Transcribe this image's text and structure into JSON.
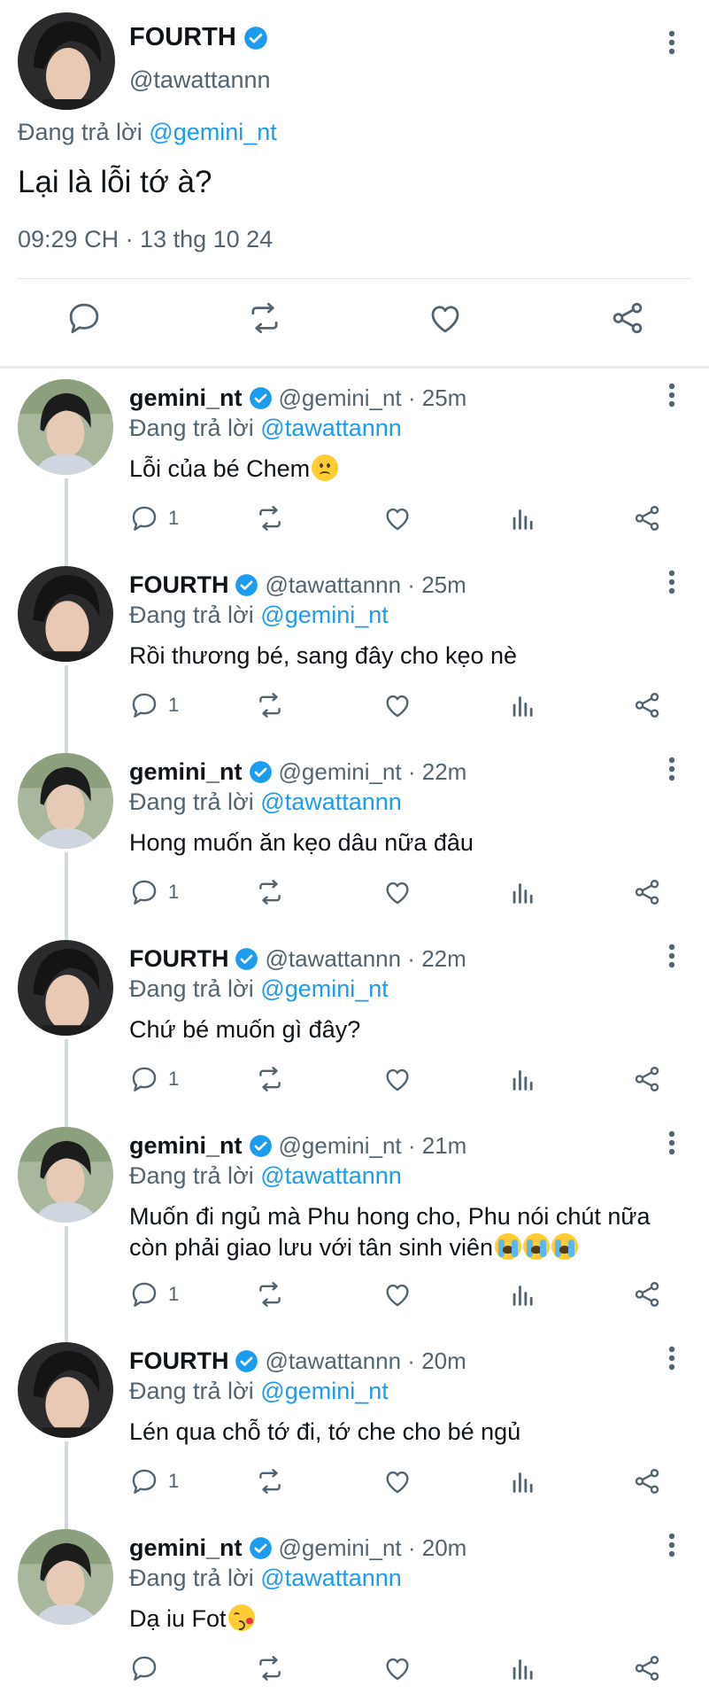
{
  "main_tweet": {
    "name": "FOURTH",
    "handle": "@tawattannn",
    "replying_prefix": "Đang trả lời",
    "replying_to": "@gemini_nt",
    "text": "Lại là lỗi tớ à?",
    "timestamp": "09:29 CH · 13 thg 10 24"
  },
  "replies": [
    {
      "name": "gemini_nt",
      "handle": "@gemini_nt · 25m",
      "replying_prefix": "Đang trả lời",
      "replying_to": "@tawattannn",
      "text": "Lỗi của bé Chem",
      "emoji": "worried-face-emoji",
      "reply_count": "1"
    },
    {
      "name": "FOURTH",
      "handle": "@tawattannn · 25m",
      "replying_prefix": "Đang trả lời",
      "replying_to": "@gemini_nt",
      "text": "Rồi thương bé, sang đây cho kẹo nè",
      "reply_count": "1"
    },
    {
      "name": "gemini_nt",
      "handle": "@gemini_nt · 22m",
      "replying_prefix": "Đang trả lời",
      "replying_to": "@tawattannn",
      "text": "Hong muốn ăn kẹo dâu nữa đâu",
      "reply_count": "1"
    },
    {
      "name": "FOURTH",
      "handle": "@tawattannn · 22m",
      "replying_prefix": "Đang trả lời",
      "replying_to": "@gemini_nt",
      "text": "Chứ bé muốn gì đây?",
      "reply_count": "1"
    },
    {
      "name": "gemini_nt",
      "handle": "@gemini_nt · 21m",
      "replying_prefix": "Đang trả lời",
      "replying_to": "@tawattannn",
      "text": "Muốn đi ngủ mà Phu hong cho, Phu nói chút nữa còn phải giao lưu với tân sinh viên",
      "emoji": "loudly-crying-face-emoji x3",
      "reply_count": "1"
    },
    {
      "name": "FOURTH",
      "handle": "@tawattannn · 20m",
      "replying_prefix": "Đang trả lời",
      "replying_to": "@gemini_nt",
      "text": "Lén qua chỗ tớ đi, tớ che cho bé ngủ",
      "reply_count": "1"
    },
    {
      "name": "gemini_nt",
      "handle": "@gemini_nt · 20m",
      "replying_prefix": "Đang trả lời",
      "replying_to": "@tawattannn",
      "text": "Dạ iu Fot",
      "emoji": "face-blowing-kiss-emoji",
      "reply_count": ""
    }
  ],
  "colors": {
    "accent": "#1d9bf0",
    "text": "#0f1419",
    "muted": "#536471",
    "divider": "#e6e9ec",
    "thread_line": "#cfd9de"
  }
}
